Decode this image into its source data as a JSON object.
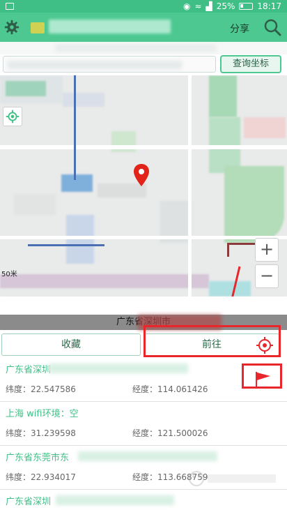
{
  "status_bar": {
    "battery": "25%",
    "time": "18:17"
  },
  "app_bar": {
    "share_label": "分享"
  },
  "query": {
    "button_label": "查询坐标"
  },
  "map": {
    "scale_label": "50米"
  },
  "address_bar": {
    "text": "广东省深圳市"
  },
  "actions": {
    "favorite_label": "收藏",
    "navigate_label": "前往"
  },
  "results": [
    {
      "title": "广东省深圳",
      "lat_label": "纬度：22.547586",
      "lng_label": "经度：114.061426"
    },
    {
      "title": "上海 wifi环境：空",
      "lat_label": "纬度：31.239598",
      "lng_label": "经度：121.500026"
    },
    {
      "title": "广东省东莞市东",
      "lat_label": "纬度：22.934017",
      "lng_label": "经度：113.668759"
    },
    {
      "title": "广东省深圳",
      "lat_label": "",
      "lng_label": ""
    }
  ],
  "colors": {
    "accent": "#4cc890",
    "link_text": "#3fbf86",
    "highlight_red": "#e8262b"
  },
  "icons": [
    "image-icon",
    "location-icon",
    "wifi-icon",
    "signal-icon",
    "battery-icon",
    "gear-icon",
    "search-icon",
    "locate-icon",
    "map-pin-icon",
    "target-icon",
    "flag-icon"
  ]
}
